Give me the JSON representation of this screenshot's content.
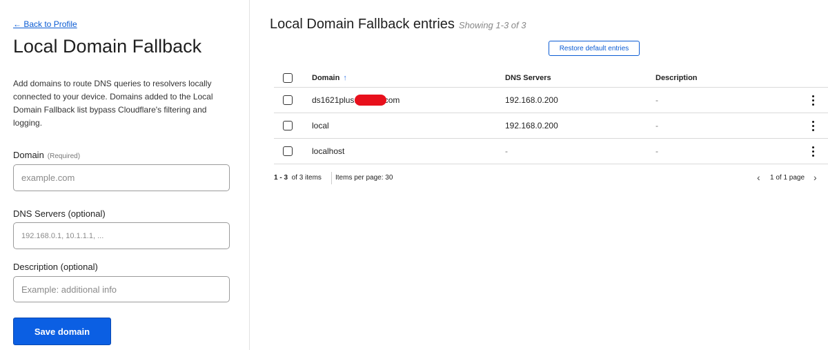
{
  "left": {
    "back_link": "← Back to Profile",
    "title": "Local Domain Fallback",
    "description": "Add domains to route DNS queries to resolvers locally connected to your device. Domains added to the Local Domain Fallback list bypass Cloudflare's filtering and logging.",
    "domain_label": "Domain",
    "domain_required": "(Required)",
    "domain_placeholder": "example.com",
    "dns_label": "DNS Servers (optional)",
    "dns_placeholder": "192.168.0.1, 10.1.1.1, ...",
    "description_label": "Description (optional)",
    "description_placeholder": "Example: additional info",
    "save_label": "Save domain"
  },
  "right": {
    "title": "Local Domain Fallback entries",
    "showing": "Showing 1-3 of 3",
    "restore_label": "Restore default entries",
    "table": {
      "headers": {
        "domain": "Domain",
        "dns": "DNS Servers",
        "description": "Description"
      },
      "rows": [
        {
          "domain_prefix": "ds1621plus.",
          "domain_suffix": "com",
          "dns": "192.168.0.200",
          "description": "-"
        },
        {
          "domain": "local",
          "dns": "192.168.0.200",
          "description": "-"
        },
        {
          "domain": "localhost",
          "dns": "-",
          "description": "-"
        }
      ]
    },
    "pager": {
      "range": "1 - 3",
      "of_items": "of 3 items",
      "per_page": "Items per page: 30",
      "page_info": "1 of 1 page"
    }
  },
  "colors": {
    "accent": "#0b5fe3",
    "link": "#0a5bd3",
    "redaction": "#e8101c"
  }
}
